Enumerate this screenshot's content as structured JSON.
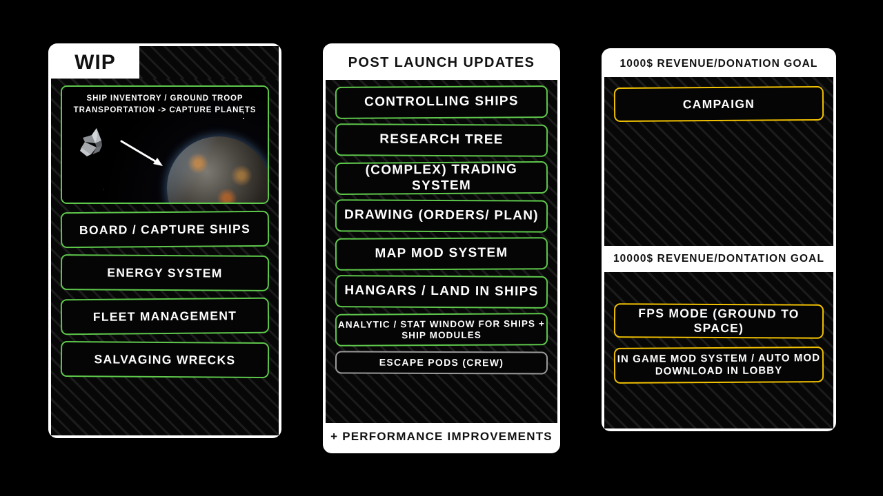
{
  "theme": {
    "background": "#000000",
    "card_border": "#ffffff",
    "green_accent": "#5ec84b",
    "gold_accent": "#f2c100",
    "grey_accent": "#9a9a9a",
    "text_light": "#ffffff",
    "text_dark": "#111111"
  },
  "card_wip": {
    "tab_label": "WIP",
    "feature_image": {
      "caption": "SHIP INVENTORY / GROUND TROOP TRANSPORTATION -> CAPTURE PLANETS",
      "alt": "spaceship with arrow pointing toward a planet"
    },
    "items": [
      {
        "label": "BOARD / CAPTURE SHIPS",
        "status": "green"
      },
      {
        "label": "ENERGY SYSTEM",
        "status": "green"
      },
      {
        "label": "FLEET MANAGEMENT",
        "status": "green"
      },
      {
        "label": "SALVAGING WRECKS",
        "status": "green"
      }
    ]
  },
  "card_post_launch": {
    "header": "POST LAUNCH UPDATES",
    "footer": "+ PERFORMANCE IMPROVEMENTS",
    "items": [
      {
        "label": "CONTROLLING SHIPS",
        "status": "green"
      },
      {
        "label": "RESEARCH TREE",
        "status": "green"
      },
      {
        "label": "(COMPLEX) TRADING SYSTEM",
        "status": "green"
      },
      {
        "label": "DRAWING (ORDERS/ PLAN)",
        "status": "green"
      },
      {
        "label": "MAP MOD SYSTEM",
        "status": "green"
      },
      {
        "label": "HANGARS / LAND IN SHIPS",
        "status": "green"
      },
      {
        "label": "ANALYTIC / STAT WINDOW FOR SHIPS + SHIP MODULES",
        "status": "green"
      },
      {
        "label": "ESCAPE PODS (CREW)",
        "status": "grey"
      }
    ]
  },
  "card_goals": {
    "header_tier1": "1000$ REVENUE/DONATION GOAL",
    "header_tier2": "10000$ REVENUE/DONTATION GOAL",
    "tier1_items": [
      {
        "label": "CAMPAIGN",
        "status": "gold"
      }
    ],
    "tier2_items": [
      {
        "label": "FPS MODE (GROUND TO SPACE)",
        "status": "gold"
      },
      {
        "label": "IN GAME MOD SYSTEM / AUTO MOD DOWNLOAD IN LOBBY",
        "status": "gold"
      }
    ]
  }
}
